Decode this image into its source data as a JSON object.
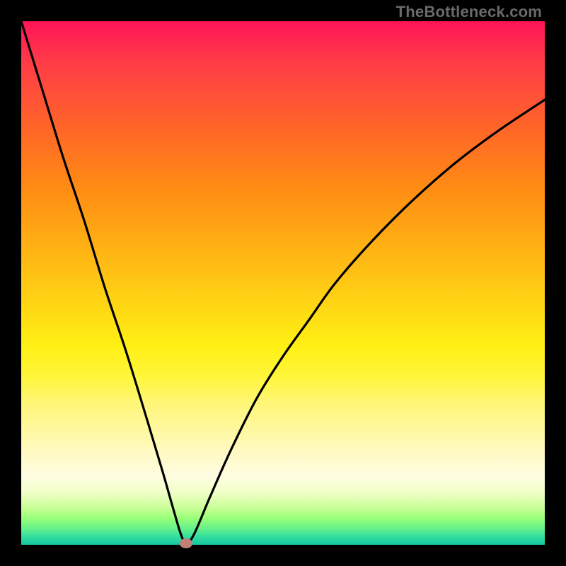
{
  "watermark": "TheBottleneck.com",
  "colors": {
    "frame_bg": "#000000",
    "curve": "#000000",
    "marker": "#c08078"
  },
  "chart_data": {
    "type": "line",
    "title": "",
    "xlabel": "",
    "ylabel": "",
    "xlim": [
      0,
      100
    ],
    "ylim": [
      0,
      100
    ],
    "series": [
      {
        "name": "bottleneck-curve",
        "x": [
          0,
          4,
          8,
          12,
          16,
          20,
          24,
          27,
          29,
          30.5,
          31.5,
          33,
          36,
          40,
          45,
          50,
          55,
          60,
          67,
          75,
          83,
          91,
          100
        ],
        "y": [
          100,
          87,
          74,
          62,
          49,
          37,
          24,
          14,
          7,
          2,
          0.3,
          2,
          9,
          18,
          28,
          36,
          43,
          50,
          58,
          66,
          73,
          79,
          85
        ]
      }
    ],
    "vertex": {
      "x": 31.5,
      "y": 0.3
    },
    "annotations": []
  }
}
